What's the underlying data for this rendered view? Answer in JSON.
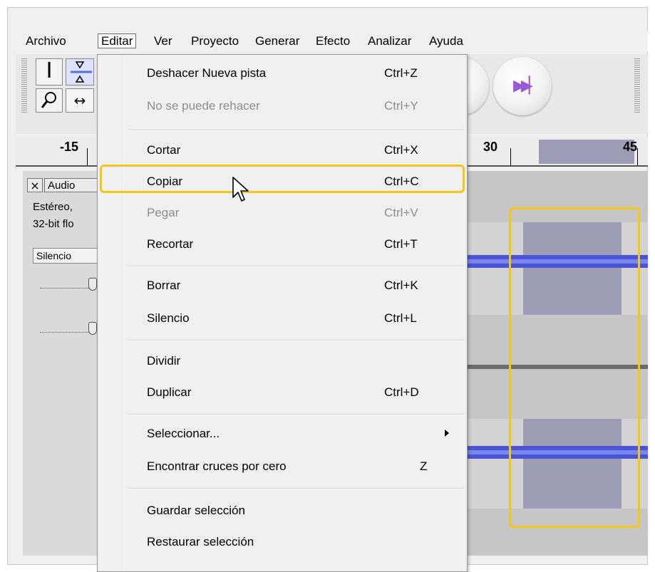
{
  "menubar": {
    "items": [
      "Archivo",
      "Editar",
      "Ver",
      "Proyecto",
      "Generar",
      "Efecto",
      "Analizar",
      "Ayuda"
    ],
    "open_item": "Editar"
  },
  "ruler": {
    "labels": [
      "-15",
      "30",
      "45"
    ]
  },
  "track": {
    "close_symbol": "×",
    "name": "Audio",
    "info_line1": "Estéreo,",
    "info_line2": "32-bit flo",
    "mute_button": "Silencio"
  },
  "edit_menu": {
    "items": [
      {
        "label": "Deshacer Nueva pista",
        "shortcut": "Ctrl+Z",
        "enabled": true
      },
      {
        "label": "No se puede rehacer",
        "shortcut": "Ctrl+Y",
        "enabled": false
      },
      {
        "label": "Cortar",
        "shortcut": "Ctrl+X",
        "enabled": true
      },
      {
        "label": "Copiar",
        "shortcut": "Ctrl+C",
        "enabled": true,
        "hovered": true
      },
      {
        "label": "Pegar",
        "shortcut": "Ctrl+V",
        "enabled": false
      },
      {
        "label": "Recortar",
        "shortcut": "Ctrl+T",
        "enabled": true
      },
      {
        "label": "Borrar",
        "shortcut": "Ctrl+K",
        "enabled": true
      },
      {
        "label": "Silencio",
        "shortcut": "Ctrl+L",
        "enabled": true
      },
      {
        "label": "Dividir",
        "shortcut": "",
        "enabled": true
      },
      {
        "label": "Duplicar",
        "shortcut": "Ctrl+D",
        "enabled": true
      },
      {
        "label": "Seleccionar...",
        "shortcut": "",
        "enabled": true,
        "submenu": true
      },
      {
        "label": "Encontrar cruces por cero",
        "shortcut": "Z",
        "enabled": true
      },
      {
        "label": "Guardar selección",
        "shortcut": "",
        "enabled": true
      },
      {
        "label": "Restaurar selección",
        "shortcut": "",
        "enabled": true
      }
    ]
  },
  "colors": {
    "highlight": "#f5c518",
    "selection": "#9d9db5",
    "waveform": "#4b55d4",
    "disabled_text": "#8d8d8d"
  },
  "icons": [
    "selection-tool-icon",
    "envelope-tool-icon",
    "zoom-tool-icon",
    "timeshift-tool-icon",
    "stop-icon",
    "skip-end-icon",
    "mouse-pointer-icon"
  ]
}
